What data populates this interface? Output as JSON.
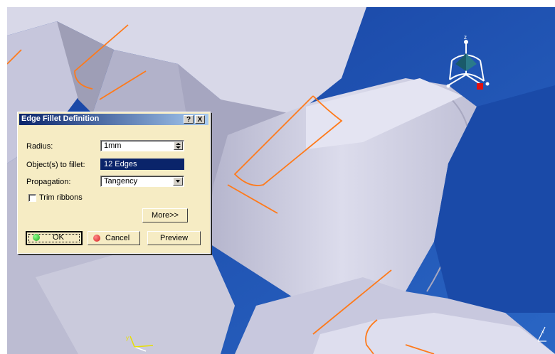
{
  "dialog": {
    "title": "Edge Fillet Definition",
    "help_button": "?",
    "close_button": "X",
    "radius": {
      "label": "Radius:",
      "value": "1mm"
    },
    "objects": {
      "label": "Object(s) to fillet:",
      "value": "12 Edges"
    },
    "propagation": {
      "label": "Propagation:",
      "value": "Tangency"
    },
    "trim_ribbons": {
      "label": "Trim ribbons",
      "checked": false
    },
    "more_button": "More>>",
    "ok_button": "OK",
    "cancel_button": "Cancel",
    "preview_button": "Preview"
  },
  "compass": {
    "z_label": "z",
    "x_label": "x",
    "y_label": "y"
  },
  "colors": {
    "viewport_bg": "#1f4fa8",
    "part_light": "#dcdceb",
    "part_mid": "#c2c2d8",
    "part_dark": "#8e8ea4",
    "edge_highlight": "#ff7a1a",
    "dialog_bg": "#f6ecc4",
    "ok_icon": "#1fa81f",
    "cancel_icon": "#d42020"
  }
}
